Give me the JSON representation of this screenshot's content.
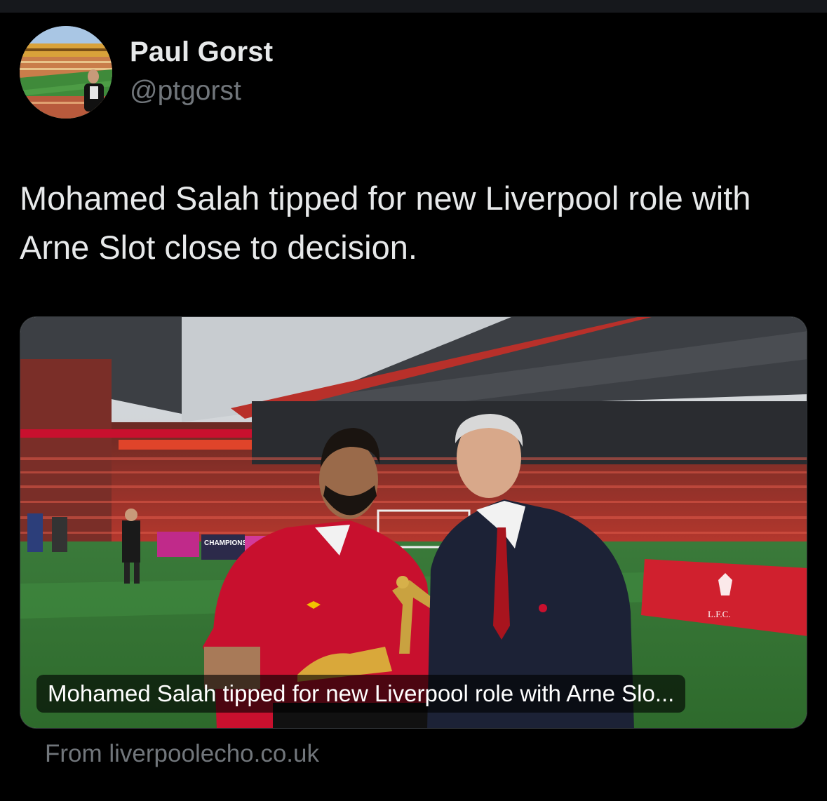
{
  "tweet": {
    "author_name": "Paul Gorst",
    "author_handle": "@ptgorst",
    "text": "Mohamed Salah tipped for new Liverpool role with Arne Slot close to decision."
  },
  "card": {
    "caption": "Mohamed Salah tipped for new Liverpool role with Arne Slo...",
    "source": "From liverpoolecho.co.uk",
    "image_banner_text": "CHAMPIONS 2024/25",
    "flag_text": "L.F.C."
  },
  "colors": {
    "background": "#000000",
    "primary_text": "#e7e9ea",
    "secondary_text": "#71767b",
    "liverpool_red": "#c8102e"
  },
  "icons": {
    "avatar": "profile-photo",
    "card_image": "article-thumbnail-photo"
  }
}
